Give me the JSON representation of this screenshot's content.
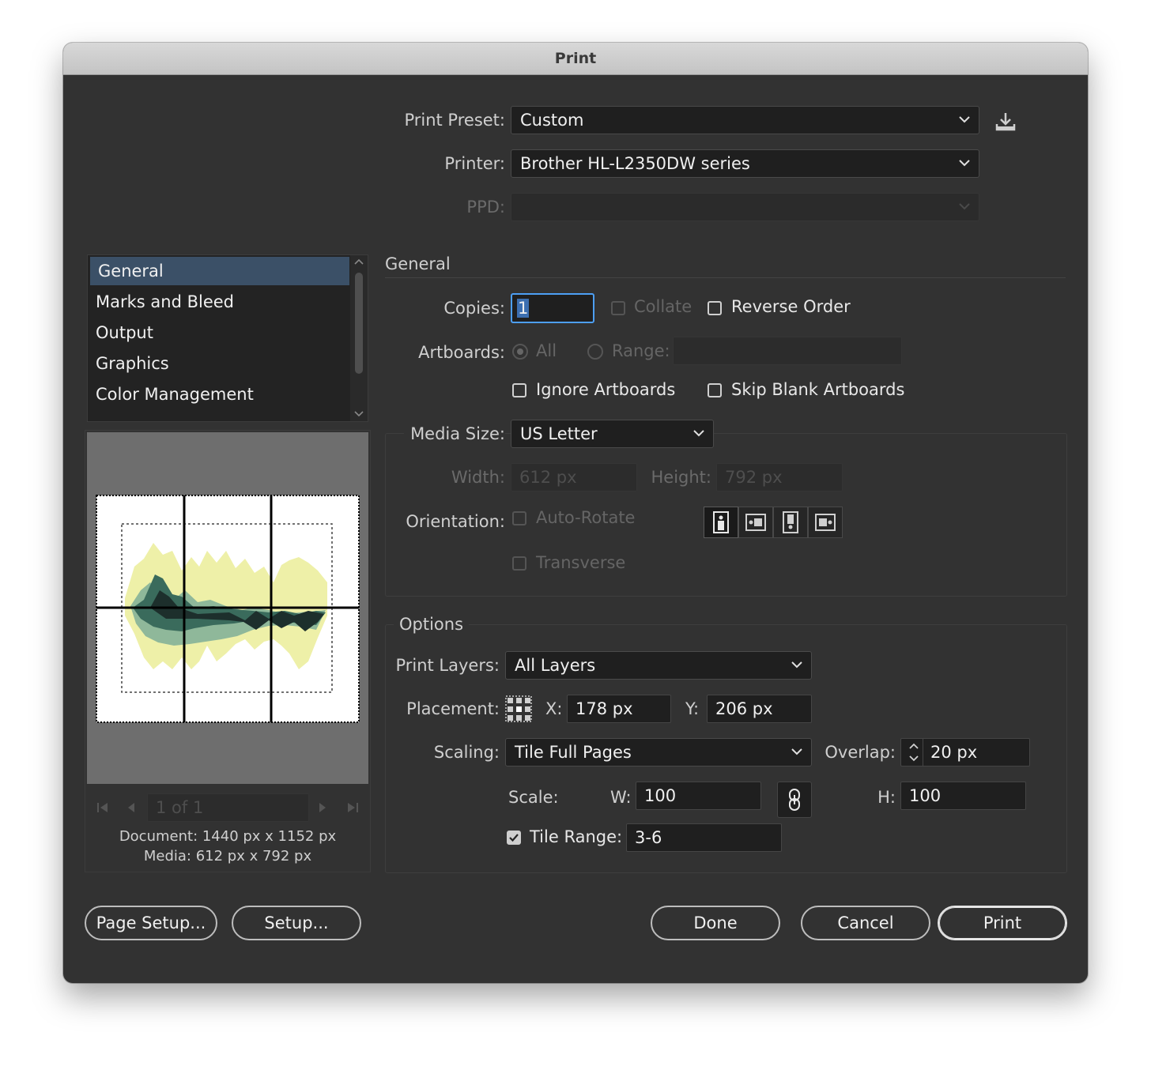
{
  "window": {
    "title": "Print"
  },
  "top": {
    "preset_label": "Print Preset:",
    "preset_value": "Custom",
    "printer_label": "Printer:",
    "printer_value": "Brother HL-L2350DW series",
    "ppd_label": "PPD:",
    "ppd_value": ""
  },
  "sidebar": {
    "items": [
      {
        "label": "General",
        "selected": true
      },
      {
        "label": "Marks and Bleed"
      },
      {
        "label": "Output"
      },
      {
        "label": "Graphics"
      },
      {
        "label": "Color Management"
      }
    ]
  },
  "preview": {
    "page_field": "1 of 1",
    "document": "Document:  1440 px x 1152 px",
    "media": "Media:  612 px x 792 px"
  },
  "general": {
    "title": "General",
    "copies_label": "Copies:",
    "copies_value": "1",
    "collate_label": "Collate",
    "reverse_label": "Reverse Order",
    "artboards_label": "Artboards:",
    "all_label": "All",
    "range_label": "Range:",
    "ignore_label": "Ignore Artboards",
    "skip_label": "Skip Blank Artboards",
    "media_label": "Media Size:",
    "media_value": "US Letter",
    "width_label": "Width:",
    "width_value": "612 px",
    "height_label": "Height:",
    "height_value": "792 px",
    "orientation_label": "Orientation:",
    "autorotate_label": "Auto-Rotate",
    "transverse_label": "Transverse"
  },
  "options": {
    "title": "Options",
    "layers_label": "Print Layers:",
    "layers_value": "All Layers",
    "placement_label": "Placement:",
    "x_label": "X:",
    "x_value": "178 px",
    "y_label": "Y:",
    "y_value": "206 px",
    "scaling_label": "Scaling:",
    "scaling_value": "Tile Full Pages",
    "overlap_label": "Overlap:",
    "overlap_value": "20 px",
    "scale_label": "Scale:",
    "w_label": "W:",
    "w_value": "100",
    "h_label": "H:",
    "h_value": "100",
    "tile_label": "Tile Range:",
    "tile_value": "3-6",
    "tile_checked": true
  },
  "buttons": {
    "page_setup": "Page Setup...",
    "setup": "Setup...",
    "done": "Done",
    "cancel": "Cancel",
    "print": "Print"
  },
  "colors": {
    "selection": "#3b5067",
    "focus": "#4d9ff5",
    "chart_light": "#eef0a8",
    "chart_mid": "#3a6b5c",
    "chart_dark": "#1d2f2c"
  }
}
